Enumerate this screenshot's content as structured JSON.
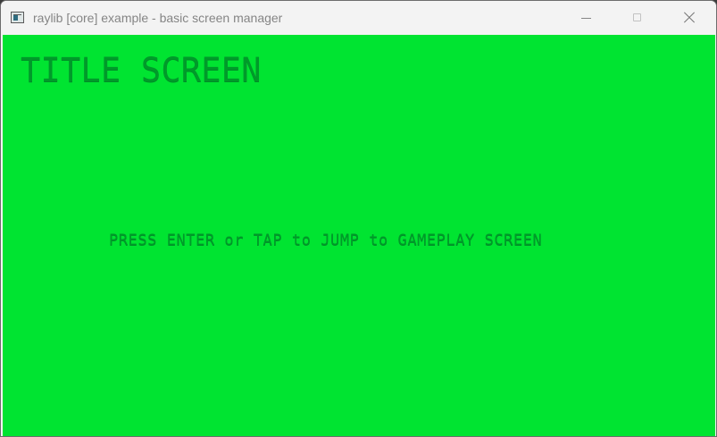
{
  "window": {
    "title": "raylib [core] example - basic screen manager",
    "icon": "raylib-window-icon",
    "controls": {
      "minimize_icon": "minimize-icon",
      "maximize_icon": "maximize-icon",
      "close_icon": "close-icon"
    }
  },
  "screen": {
    "title": "TITLE SCREEN",
    "instruction": "PRESS ENTER or TAP to JUMP to GAMEPLAY SCREEN"
  },
  "colors": {
    "background": "#00e431",
    "text": "#009a2a",
    "titlebar": "#f3f3f3"
  }
}
